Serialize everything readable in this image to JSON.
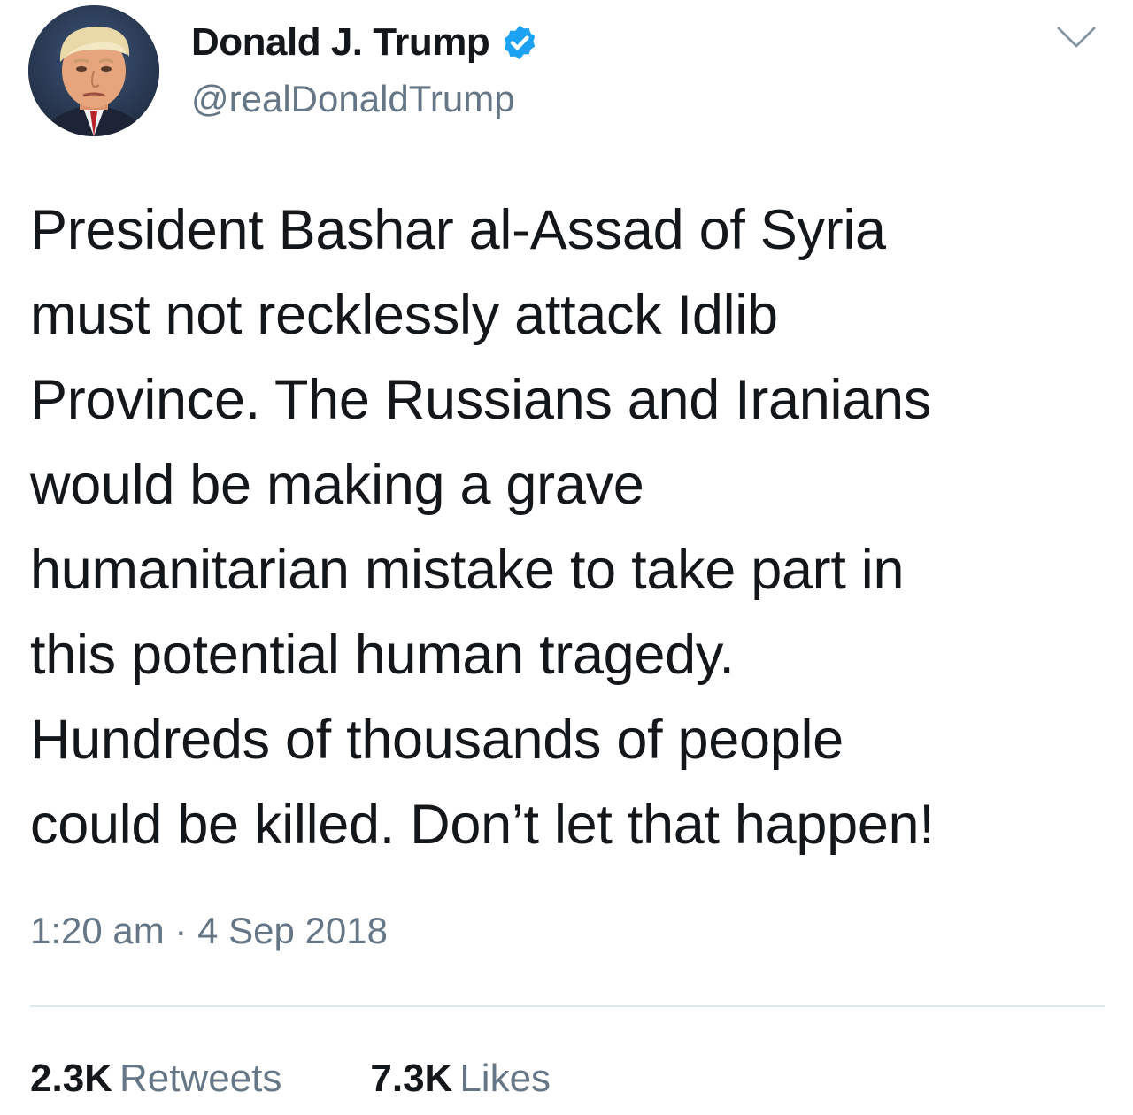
{
  "author": {
    "display_name": "Donald J. Trump",
    "handle": "@realDonaldTrump",
    "verified": true,
    "avatar_icon": "profile-photo",
    "verified_icon": "verified-badge-icon"
  },
  "menu": {
    "icon": "chevron-down-icon"
  },
  "tweet": {
    "lines": [
      "President Bashar al-Assad of Syria",
      "must not recklessly attack Idlib",
      "Province. The Russians and Iranians",
      "would be making a grave",
      "humanitarian mistake to take part in",
      "this potential human tragedy.",
      "Hundreds of thousands of people",
      "could be killed. Don’t let that happen!"
    ],
    "timestamp": "1:20 am · 4 Sep 2018"
  },
  "stats": {
    "retweets": {
      "count": "2.3K",
      "label": "Retweets"
    },
    "likes": {
      "count": "7.3K",
      "label": "Likes"
    }
  },
  "colors": {
    "text": "#14171a",
    "secondary_text": "#657786",
    "verified_blue": "#1da1f2",
    "divider": "#e1e8ed"
  }
}
